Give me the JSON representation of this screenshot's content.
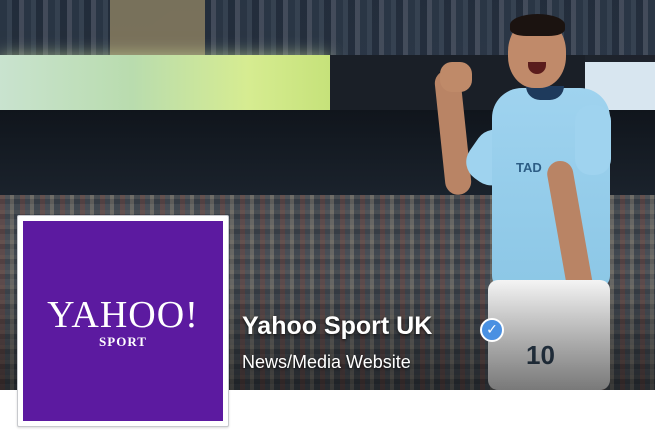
{
  "page": {
    "name": "Yahoo Sport UK",
    "category": "News/Media Website",
    "verified_icon": "check-icon"
  },
  "profile": {
    "logo_text": "YAHOO!",
    "logo_subtext": "SPORT",
    "brand_color": "#5c1aa0"
  },
  "cover": {
    "shirt_sponsor": "TAD",
    "shirt_number": "10"
  },
  "colors": {
    "verified_badge": "#4a90e2",
    "text_on_cover": "#ffffff"
  }
}
